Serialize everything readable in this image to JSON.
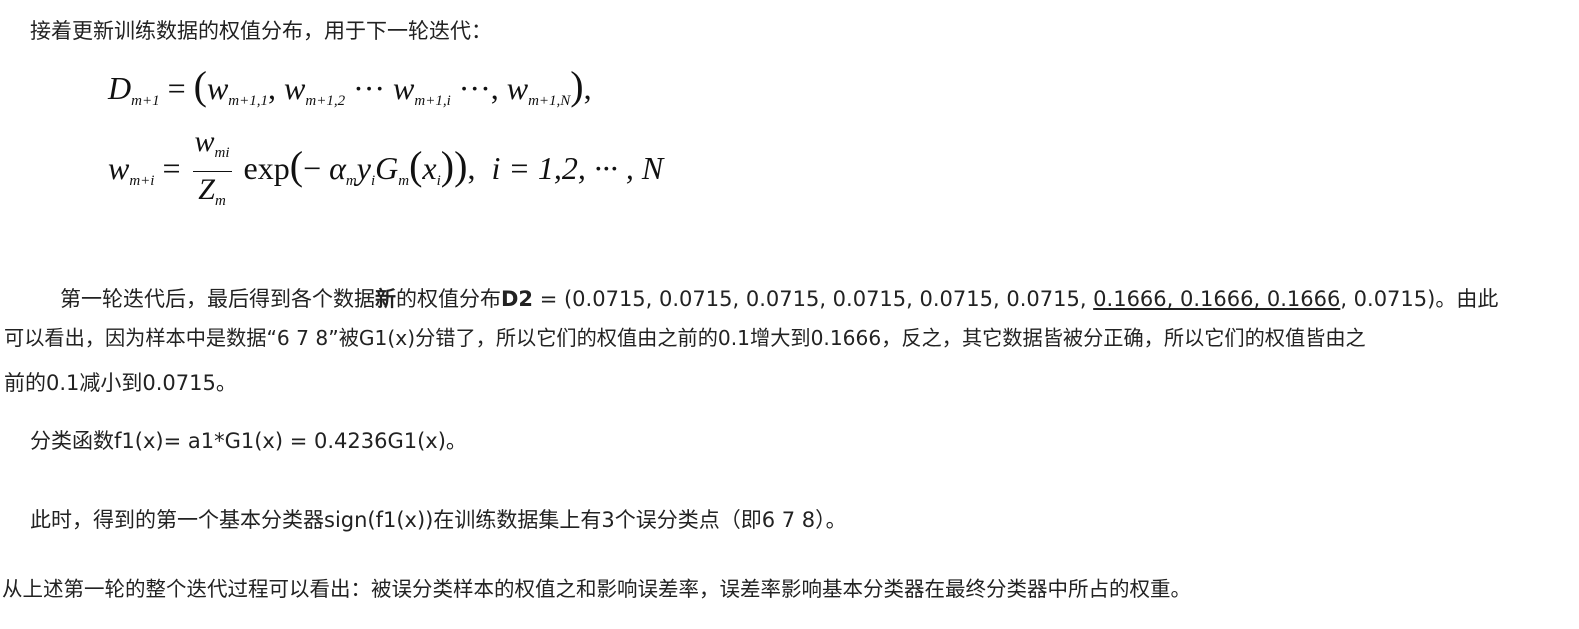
{
  "intro": "接着更新训练数据的权值分布，用于下一轮迭代：",
  "formula1": {
    "lhs": "D",
    "lhs_sub": "m+1",
    "eq": "=",
    "open": "(",
    "w1": "w",
    "w1_sub": "m+1,1",
    "sep1": ",",
    "w2": "w",
    "w2_sub": "m+1,2",
    "dots1": "···",
    "w3": "w",
    "w3_sub": "m+1,i",
    "dots2": "···,",
    "w4": "w",
    "w4_sub": "m+1,N",
    "close": ")",
    "end": ","
  },
  "formula2": {
    "lhs": "w",
    "lhs_sub": "m+i",
    "eq": "=",
    "num": "w",
    "num_sub": "mi",
    "den": "Z",
    "den_sub": "m",
    "exp": "exp",
    "open": "(",
    "minus": "−",
    "alpha": "α",
    "alpha_sub": "m",
    "y": "y",
    "y_sub": "i",
    "G": "G",
    "G_sub": "m",
    "x_open": "(",
    "x": "x",
    "x_sub": "i",
    "x_close": ")",
    "close": ")",
    "comma": ",",
    "range": "i = 1,2, ··· , N"
  },
  "para1": {
    "line1_a": "第一轮迭代后，最后得到各个数据",
    "line1_b": "新",
    "line1_c": "的权值分布",
    "line1_d": "D2",
    "line1_e": " = (0.0715, 0.0715, 0.0715, 0.0715, 0.0715,  0.0715, ",
    "line1_f": "0.1666, 0.1666, 0.1666",
    "line1_g": ", 0.0715)。由此",
    "line2": "可以看出，因为样本中是数据“6 7 8”被G1(x)分错了，所以它们的权值由之前的0.1增大到0.1666，反之，其它数据皆被分正确，所以它们的权值皆由之",
    "line3": "前的0.1减小到0.0715。"
  },
  "classifier": "分类函数f1(x)= a1*G1(x) = 0.4236G1(x)。",
  "sign_line": "此时，得到的第一个基本分类器sign(f1(x))在训练数据集上有3个误分类点（即6 7 8）。",
  "conclusion": "从上述第一轮的整个迭代过程可以看出：被误分类样本的权值之和影响误差率，误差率影响基本分类器在最终分类器中所占的权重。"
}
